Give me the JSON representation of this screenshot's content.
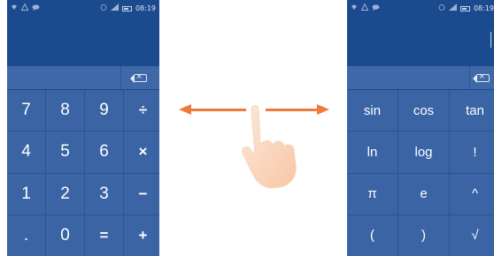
{
  "left_screen": {
    "status_time": "08:19",
    "keys": [
      [
        "7",
        "8",
        "9",
        "÷"
      ],
      [
        "4",
        "5",
        "6",
        "×"
      ],
      [
        "1",
        "2",
        "3",
        "−"
      ],
      [
        ".",
        "0",
        "=",
        "+"
      ]
    ]
  },
  "right_screen": {
    "status_time": "08:19",
    "keys": [
      [
        "sin",
        "cos",
        "tan"
      ],
      [
        "ln",
        "log",
        "!"
      ],
      [
        "π",
        "e",
        "^"
      ],
      [
        "(",
        ")",
        "√"
      ]
    ]
  },
  "colors": {
    "status_and_display": "#1c4a8e",
    "key_background": "#3a64a4",
    "edit_row": "#3f68a8",
    "swipe_arrows": "#f07a3c"
  },
  "icons": [
    "wifi-icon",
    "warning-icon",
    "message-icon",
    "alarm-icon",
    "signal-icon",
    "battery-icon",
    "backspace-icon",
    "swipe-hand-icon"
  ]
}
